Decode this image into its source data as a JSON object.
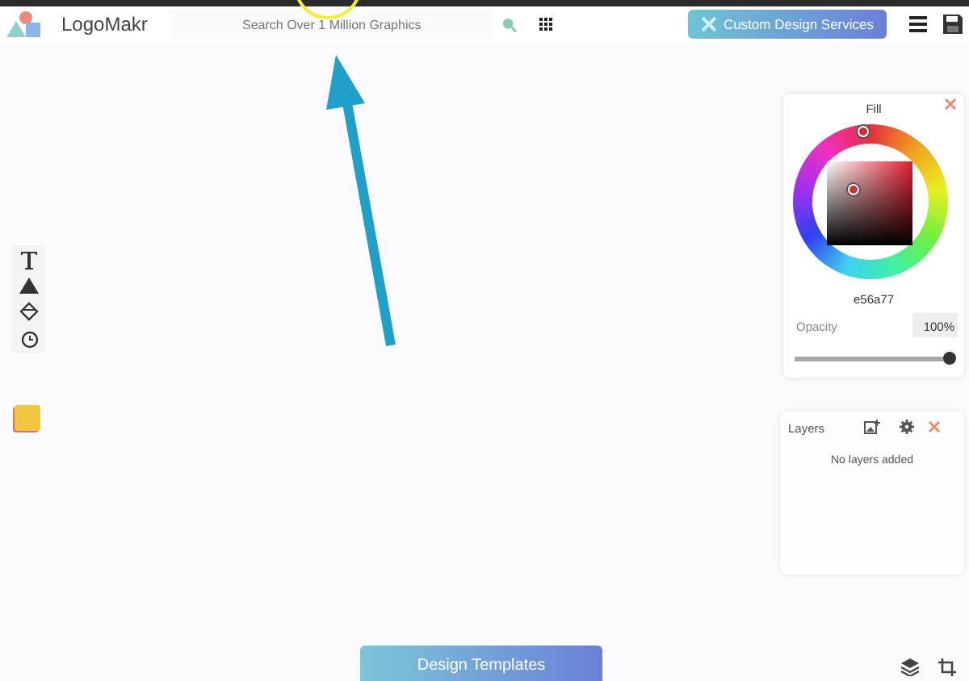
{
  "header": {
    "logo_text": "LogoMakr",
    "search": {
      "placeholder": "Search Over 1 Million Graphics"
    },
    "service_button": "Custom Design Services"
  },
  "color_panel": {
    "title": "Fill",
    "hex": "e56a77",
    "opacity_label": "Opacity",
    "opacity_value": "100%",
    "opacity": {
      "level": 1.0
    }
  },
  "layers_panel": {
    "title": "Layers",
    "empty_text": "No layers added"
  },
  "templates_button": "Design Templates"
}
